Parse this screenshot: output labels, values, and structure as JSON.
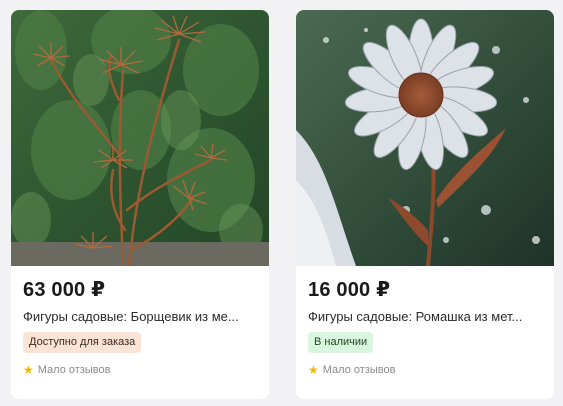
{
  "products": [
    {
      "price": "63 000 ₽",
      "title": "Фигуры садовые: Борщевик из ме...",
      "badge": "Доступно для заказа",
      "rating_text": "Мало отзывов",
      "image_icon": "metal-hogweed-sculpture",
      "badge_color": "#fbe4d5"
    },
    {
      "price": "16 000 ₽",
      "title": "Фигуры садовые: Ромашка из мет...",
      "badge": "В наличии",
      "rating_text": "Мало отзывов",
      "image_icon": "metal-daisy-sculpture",
      "badge_color": "#dbf6de"
    }
  ],
  "colors": {
    "star": "#f5b400",
    "background": "#f2f1f4"
  }
}
